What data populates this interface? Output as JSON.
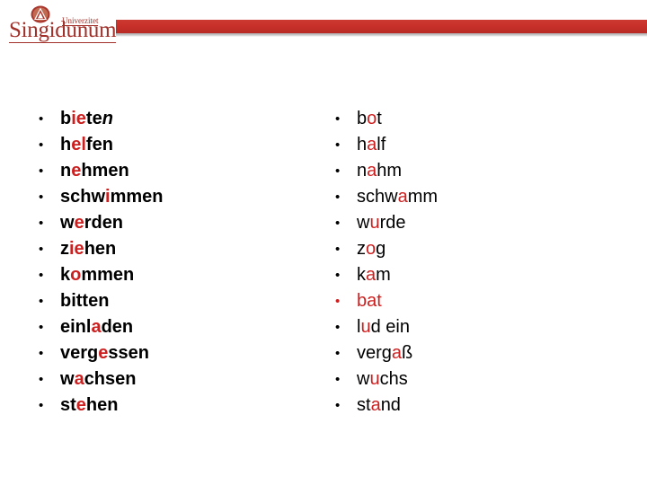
{
  "header": {
    "brand_wordmark": "Singidunum",
    "brand_subword": "Univerzitet",
    "crest_icon": "mountain-crest-icon",
    "rule_color": "#c8302a",
    "wordmark_color": "#a03029"
  },
  "slide": {
    "background_color": "#ffffff",
    "highlight_color": "#cc1f1f",
    "text_color": "#000000",
    "bullet_glyph": "•"
  },
  "columns": [
    {
      "id": "infinitive",
      "weight": "bold",
      "items": [
        {
          "text": "bieten",
          "segments": [
            {
              "t": "b",
              "s": "plain"
            },
            {
              "t": "ie",
              "s": "highlight"
            },
            {
              "t": "te",
              "s": "plain"
            },
            {
              "t": "n",
              "s": "italic"
            }
          ]
        },
        {
          "text": "helfen",
          "segments": [
            {
              "t": "h",
              "s": "plain"
            },
            {
              "t": "el",
              "s": "highlight"
            },
            {
              "t": "fen",
              "s": "plain"
            }
          ]
        },
        {
          "text": "nehmen",
          "segments": [
            {
              "t": "n",
              "s": "plain"
            },
            {
              "t": "e",
              "s": "highlight"
            },
            {
              "t": "hmen",
              "s": "plain"
            }
          ]
        },
        {
          "text": "schwimmen",
          "segments": [
            {
              "t": "schw",
              "s": "plain"
            },
            {
              "t": "i",
              "s": "highlight"
            },
            {
              "t": "mmen",
              "s": "plain"
            }
          ]
        },
        {
          "text": "werden",
          "segments": [
            {
              "t": "w",
              "s": "plain"
            },
            {
              "t": "e",
              "s": "highlight"
            },
            {
              "t": "rden",
              "s": "plain"
            }
          ]
        },
        {
          "text": "ziehen",
          "segments": [
            {
              "t": "z",
              "s": "plain"
            },
            {
              "t": "ie",
              "s": "highlight"
            },
            {
              "t": "hen",
              "s": "plain"
            }
          ]
        },
        {
          "text": "kommen",
          "segments": [
            {
              "t": "k",
              "s": "plain"
            },
            {
              "t": "o",
              "s": "highlight"
            },
            {
              "t": "mmen",
              "s": "plain"
            }
          ]
        },
        {
          "text": "bitten",
          "segments": [
            {
              "t": "bitten",
              "s": "plain"
            }
          ]
        },
        {
          "text": "einladen",
          "segments": [
            {
              "t": "einl",
              "s": "plain"
            },
            {
              "t": "a",
              "s": "highlight"
            },
            {
              "t": "den",
              "s": "plain"
            }
          ]
        },
        {
          "text": "vergessen",
          "segments": [
            {
              "t": "verg",
              "s": "plain"
            },
            {
              "t": "e",
              "s": "highlight"
            },
            {
              "t": "ssen",
              "s": "plain"
            }
          ]
        },
        {
          "text": "wachsen",
          "segments": [
            {
              "t": "w",
              "s": "plain"
            },
            {
              "t": "a",
              "s": "highlight"
            },
            {
              "t": "chsen",
              "s": "plain"
            }
          ]
        },
        {
          "text": "stehen",
          "segments": [
            {
              "t": "st",
              "s": "plain"
            },
            {
              "t": "e",
              "s": "highlight"
            },
            {
              "t": "hen",
              "s": "plain"
            }
          ]
        }
      ]
    },
    {
      "id": "preterite",
      "weight": "normal",
      "items": [
        {
          "text": "bot",
          "segments": [
            {
              "t": "b",
              "s": "plain"
            },
            {
              "t": "o",
              "s": "highlight"
            },
            {
              "t": "t",
              "s": "plain"
            }
          ]
        },
        {
          "text": "half",
          "segments": [
            {
              "t": "h",
              "s": "plain"
            },
            {
              "t": "a",
              "s": "highlight"
            },
            {
              "t": "lf",
              "s": "plain"
            }
          ]
        },
        {
          "text": "nahm",
          "segments": [
            {
              "t": "n",
              "s": "plain"
            },
            {
              "t": "a",
              "s": "highlight"
            },
            {
              "t": "hm",
              "s": "plain"
            }
          ]
        },
        {
          "text": "schwamm",
          "segments": [
            {
              "t": "schw",
              "s": "plain"
            },
            {
              "t": "a",
              "s": "highlight"
            },
            {
              "t": "mm",
              "s": "plain"
            }
          ]
        },
        {
          "text": "wurde",
          "segments": [
            {
              "t": "w",
              "s": "plain"
            },
            {
              "t": "u",
              "s": "highlight"
            },
            {
              "t": "rde",
              "s": "plain"
            }
          ]
        },
        {
          "text": "zog",
          "segments": [
            {
              "t": "z",
              "s": "plain"
            },
            {
              "t": "o",
              "s": "highlight"
            },
            {
              "t": "g",
              "s": "plain"
            }
          ]
        },
        {
          "text": "kam",
          "segments": [
            {
              "t": "k",
              "s": "plain"
            },
            {
              "t": "a",
              "s": "highlight"
            },
            {
              "t": "m",
              "s": "plain"
            }
          ]
        },
        {
          "text": "bat",
          "all_red": true,
          "segments": [
            {
              "t": "bat",
              "s": "plain"
            }
          ]
        },
        {
          "text": "lud ein",
          "segments": [
            {
              "t": "l",
              "s": "plain"
            },
            {
              "t": "u",
              "s": "highlight"
            },
            {
              "t": "d ein",
              "s": "plain"
            }
          ]
        },
        {
          "text": "vergaß",
          "segments": [
            {
              "t": "verg",
              "s": "plain"
            },
            {
              "t": "a",
              "s": "highlight"
            },
            {
              "t": "ß",
              "s": "plain"
            }
          ]
        },
        {
          "text": "wuchs",
          "segments": [
            {
              "t": "w",
              "s": "plain"
            },
            {
              "t": "u",
              "s": "highlight"
            },
            {
              "t": "chs",
              "s": "plain"
            }
          ]
        },
        {
          "text": "stand",
          "segments": [
            {
              "t": "st",
              "s": "plain"
            },
            {
              "t": "a",
              "s": "highlight"
            },
            {
              "t": "nd",
              "s": "plain"
            }
          ]
        }
      ]
    }
  ]
}
